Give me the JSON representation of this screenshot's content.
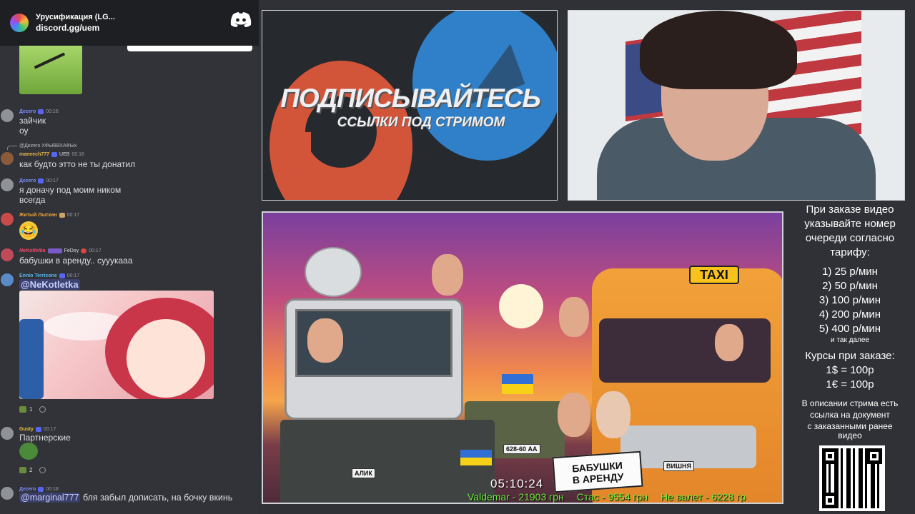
{
  "server": {
    "name": "Урусификация (LG...",
    "invite": "discord.gg/uem"
  },
  "messages": [
    {
      "user": "Дezero",
      "time": "00:16",
      "lines": [
        "зайчик",
        "оу"
      ]
    },
    {
      "reply_to": "@Дezero ХФЫВВХАФЫх",
      "user": "maneech777",
      "tag": "UEB",
      "time": "00:16",
      "lines": [
        "как будто этто не ты донатил"
      ]
    },
    {
      "user": "Дezero",
      "time": "00:17",
      "lines": [
        "я доначу под моим ником",
        "всегда"
      ]
    },
    {
      "user": "Житый Лыткин",
      "time": "00:17",
      "lines": []
    },
    {
      "user": "NeKotletka",
      "tag": "FeDoy",
      "time": "00:17",
      "lines": [
        "бабушки в аренду.. сууукааа"
      ]
    },
    {
      "user": "Ennio Terricone",
      "time": "00:17",
      "lines": [
        "@NeKotletka"
      ]
    },
    {
      "reaction_count": "1"
    },
    {
      "user": "Gusty",
      "time": "00:17",
      "lines": [
        "Партнерские"
      ]
    },
    {
      "reaction_count": "2"
    },
    {
      "user": "Дezero",
      "time": "00:18",
      "mention": "@marginal777",
      "lines": [
        "бля забыл дописать, на бочку вкинь"
      ]
    }
  ],
  "promo": {
    "title": "ПОДПИСЫВАЙТЕСЬ",
    "subtitle": "ССЫЛКИ ПОД СТРИМОМ"
  },
  "video": {
    "taxi": "TAXI",
    "plate_left": "АЛИК",
    "plate_tank": "628-60 АА",
    "plate_van": "ВИШНЯ",
    "sign": [
      "БАБУШКИ",
      "В АРЕНДУ"
    ],
    "timer": "05:10:24",
    "donations": [
      "Valdemar - 21903 грн",
      "Стас - 9554 грн",
      "Не валет - 6228 гр"
    ]
  },
  "info": {
    "order_note": [
      "При заказе видео",
      "указывайте номер",
      "очереди согласно",
      "тарифу:"
    ],
    "tariffs": [
      "1) 25 р/мин",
      "2) 50 р/мин",
      "3) 100 р/мин",
      "4) 200 р/мин",
      "5) 400 р/мин"
    ],
    "and_more": "и так далее",
    "rates_title": "Курсы при заказе:",
    "rates": [
      "1$ = 100р",
      "1€ = 100р"
    ],
    "description_note": [
      "В описании стрима есть",
      "ссылка на документ",
      "с заказанными ранее",
      "видео"
    ]
  },
  "colors": {
    "chat_bg": "#313338",
    "header_bg": "#1e1f22",
    "ticker": "#6cf03a",
    "taxi_yellow": "#f7c21b"
  }
}
